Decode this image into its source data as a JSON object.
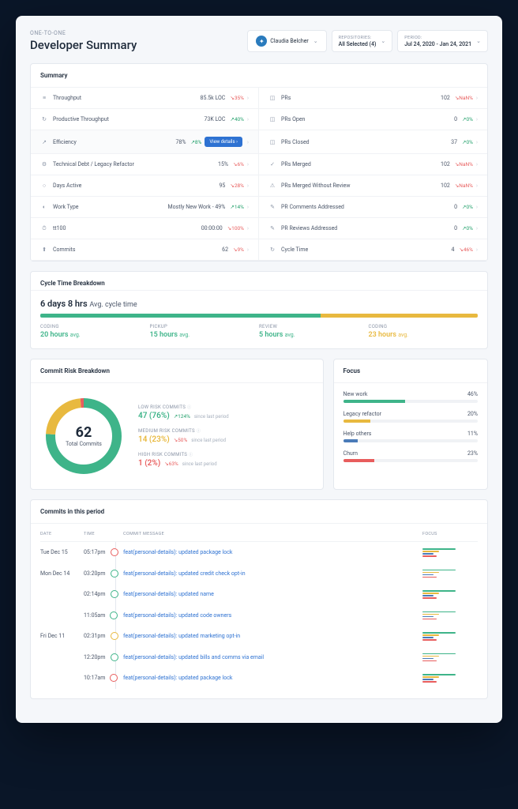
{
  "breadcrumb": "ONE-TO-ONE",
  "title": "Developer Summary",
  "person": "Claudia Belcher",
  "repos": {
    "label": "REPOSITORIES:",
    "value": "All Selected (4)"
  },
  "period": {
    "label": "PERIOD:",
    "value": "Jul 24, 2020 - Jan 24, 2021"
  },
  "summary_title": "Summary",
  "summary": [
    {
      "icon": "≡",
      "name": "Throughput",
      "value": "85.5k LOC",
      "delta": "↘35%",
      "dir": "down"
    },
    {
      "icon": "◫",
      "name": "PRs",
      "value": "102",
      "delta": "↘NaN%",
      "dir": "nan"
    },
    {
      "icon": "↻",
      "name": "Productive Throughput",
      "value": "73K LOC",
      "delta": "↗40%",
      "dir": "up"
    },
    {
      "icon": "◫",
      "name": "PRs Open",
      "value": "0",
      "delta": "↗0%",
      "dir": "up"
    },
    {
      "icon": "↗",
      "name": "Efficiency",
      "value": "78%",
      "delta": "↗8%",
      "dir": "up",
      "highlight": true,
      "btn": "View details"
    },
    {
      "icon": "◫",
      "name": "PRs Closed",
      "value": "37",
      "delta": "↗0%",
      "dir": "up"
    },
    {
      "icon": "⚙",
      "name": "Technical Debt / Legacy Refactor",
      "value": "15%",
      "delta": "↘6%",
      "dir": "down"
    },
    {
      "icon": "✓",
      "name": "PRs Merged",
      "value": "102",
      "delta": "↘NaN%",
      "dir": "nan"
    },
    {
      "icon": "○",
      "name": "Days Active",
      "value": "95",
      "delta": "↘28%",
      "dir": "down"
    },
    {
      "icon": "⚠",
      "name": "PRs Merged Without Review",
      "value": "102",
      "delta": "↘NaN%",
      "dir": "nan"
    },
    {
      "icon": "◐",
      "name": "Work Type",
      "value": "Mostly New Work - 49%",
      "delta": "↗14%",
      "dir": "up"
    },
    {
      "icon": "✎",
      "name": "PR Comments Addressed",
      "value": "0",
      "delta": "↗0%",
      "dir": "up"
    },
    {
      "icon": "⏱",
      "name": "tt100",
      "value": "00:00:00",
      "delta": "↘100%",
      "dir": "down",
      "green": true
    },
    {
      "icon": "✎",
      "name": "PR Reviews Addressed",
      "value": "0",
      "delta": "↗0%",
      "dir": "up"
    },
    {
      "icon": "⬆",
      "name": "Commits",
      "value": "62",
      "delta": "↘9%",
      "dir": "down"
    },
    {
      "icon": "↻",
      "name": "Cycle Time",
      "value": "4",
      "delta": "↘46%",
      "dir": "down"
    }
  ],
  "cycle": {
    "title": "Cycle Time Breakdown",
    "avg_value": "6 days 8 hrs",
    "avg_label": "Avg. cycle time",
    "stages": [
      {
        "name": "CODING",
        "value": "20 hours",
        "color": "#3eb489",
        "pct": 32
      },
      {
        "name": "PICKUP",
        "value": "15 hours",
        "color": "#3eb489",
        "pct": 24
      },
      {
        "name": "REVIEW",
        "value": "5 hours",
        "color": "#3eb489",
        "pct": 8
      },
      {
        "name": "CODING",
        "value": "23 hours",
        "color": "#e8b93f",
        "pct": 36
      }
    ]
  },
  "chart_data": {
    "type": "pie",
    "title": "Commit Risk Breakdown",
    "total": 62,
    "total_label": "Total Commits",
    "series": [
      {
        "name": "LOW RISK COMMITS",
        "count": 47,
        "pct": "76%",
        "delta": "↗124%",
        "dir": "up",
        "period": "since last period",
        "color": "#3eb489"
      },
      {
        "name": "MEDIUM RISK COMMITS",
        "count": 14,
        "pct": "23%",
        "delta": "↘50%",
        "dir": "down",
        "period": "since last period",
        "color": "#e8b93f"
      },
      {
        "name": "HIGH RISK COMMITS",
        "count": 1,
        "pct": "2%",
        "delta": "↘63%",
        "dir": "down",
        "period": "since last period",
        "color": "#e85d5d"
      }
    ]
  },
  "focus": {
    "title": "Focus",
    "items": [
      {
        "name": "New work",
        "pct": 46,
        "color": "#3eb489"
      },
      {
        "name": "Legacy refactor",
        "pct": 20,
        "color": "#e8b93f"
      },
      {
        "name": "Help others",
        "pct": 11,
        "color": "#4a7bb8"
      },
      {
        "name": "Churn",
        "pct": 23,
        "color": "#e85d5d"
      }
    ]
  },
  "commits": {
    "title": "Commits in this period",
    "headers": {
      "date": "DATE",
      "time": "TIME",
      "msg": "COMMIT MESSAGE",
      "focus": "FOCUS"
    },
    "rows": [
      {
        "date": "Tue Dec 15",
        "time": "05:17pm",
        "risk": "#e85d5d",
        "msg": "feat(personal-details): updated package lock"
      },
      {
        "date": "Mon Dec 14",
        "time": "03:20pm",
        "risk": "#3eb489",
        "msg": "feat(personal-details): updated credit check opt-in"
      },
      {
        "date": "",
        "time": "02:14pm",
        "risk": "#3eb489",
        "msg": "feat(personal-details): updated name"
      },
      {
        "date": "",
        "time": "11:05am",
        "risk": "#3eb489",
        "msg": "feat(personal-details): updated code owners"
      },
      {
        "date": "Fri Dec 11",
        "time": "02:31pm",
        "risk": "#e8b93f",
        "msg": "feat(personal-details): updated marketing opt-in"
      },
      {
        "date": "",
        "time": "12:20pm",
        "risk": "#3eb489",
        "msg": "feat(personal-details): updated bills and comms via email"
      },
      {
        "date": "",
        "time": "10:17am",
        "risk": "#e85d5d",
        "msg": "feat(personal-details): updated package lock"
      }
    ]
  }
}
